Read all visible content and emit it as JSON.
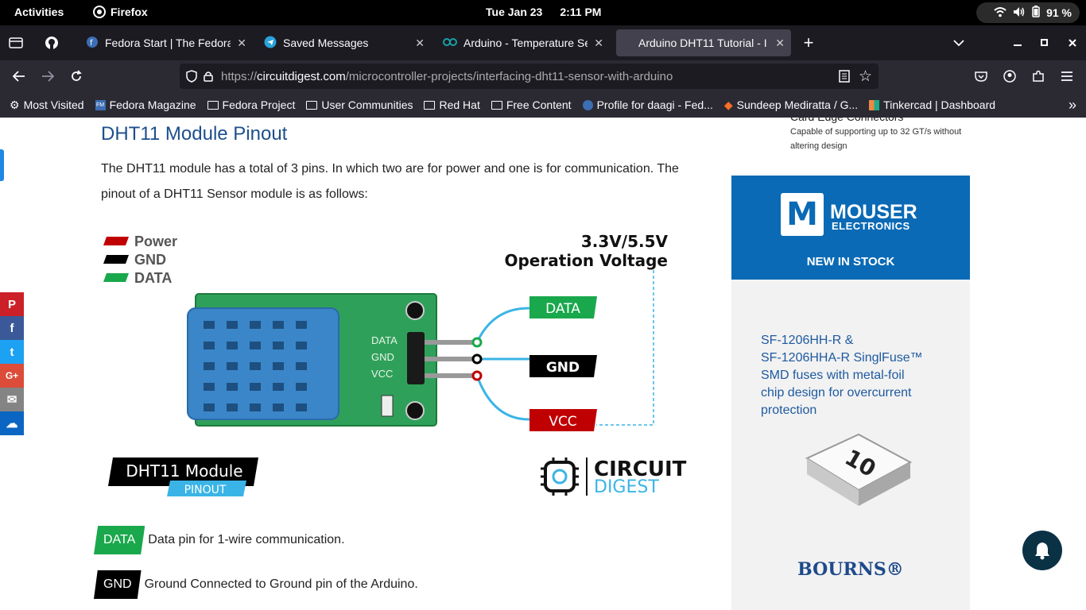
{
  "topbar": {
    "activities": "Activities",
    "app": "Firefox",
    "date": "Tue Jan 23",
    "time": "2:11 PM",
    "battery": "91 %"
  },
  "tabs": [
    {
      "title": "Fedora Start | The Fedora"
    },
    {
      "title": "Saved Messages"
    },
    {
      "title": "Arduino - Temperature Se"
    },
    {
      "title": "Arduino DHT11 Tutorial - I"
    }
  ],
  "urlbar": {
    "scheme": "https://",
    "host": "circuitdigest.com",
    "path": "/microcontroller-projects/interfacing-dht11-sensor-with-arduino"
  },
  "bookmarks": [
    "Most Visited",
    "Fedora Magazine",
    "Fedora Project",
    "User Communities",
    "Red Hat",
    "Free Content",
    "Profile for daagi - Fed...",
    "Sundeep Mediratta / G...",
    "Tinkercad | Dashboard"
  ],
  "article": {
    "heading": "DHT11 Module Pinout",
    "paragraph": "The DHT11 module has a total of 3 pins. In which two are for power and one is for communication. The pinout of a DHT11 Sensor module is as follows:",
    "pins": [
      {
        "tag": "DATA",
        "desc": "Data pin for 1-wire communication.",
        "color": "#1aa84c"
      },
      {
        "tag": "GND",
        "desc": "Ground Connected to Ground pin of the Arduino.",
        "color": "#000000"
      }
    ]
  },
  "diagram": {
    "legend": [
      "Power",
      "GND",
      "DATA"
    ],
    "voltage_line1": "3.3V/5.5V",
    "voltage_line2": "Operation Voltage",
    "labels": [
      "DATA",
      "GND",
      "VCC"
    ],
    "board_labels": [
      "DATA",
      "GND",
      "VCC"
    ],
    "title": "DHT11 Module",
    "subtitle": "PINOUT",
    "logo_line1": "CIRCUIT",
    "logo_line2": "DIGEST",
    "colors": {
      "power": "#c00000",
      "gnd": "#000000",
      "data": "#1aa84c",
      "wire": "#3ab4e6"
    }
  },
  "sidebar": {
    "partial_title": "Card Edge Connectors",
    "desc_line1": "Capable of supporting up to 32 GT/s without",
    "desc_line2": "altering design"
  },
  "ad": {
    "brand1": "MOUSER",
    "brand2": "ELECTRONICS",
    "tagline": "NEW IN STOCK",
    "body_lines": [
      "SF-1206HH-R &",
      "SF-1206HHA-R SinglFuse™",
      "SMD fuses with metal-foil",
      "chip design for overcurrent",
      "protection"
    ],
    "chip_text": "10",
    "footer": "BOURNS®"
  },
  "share": [
    "P",
    "f",
    "t",
    "G+",
    "✉",
    "☁"
  ]
}
